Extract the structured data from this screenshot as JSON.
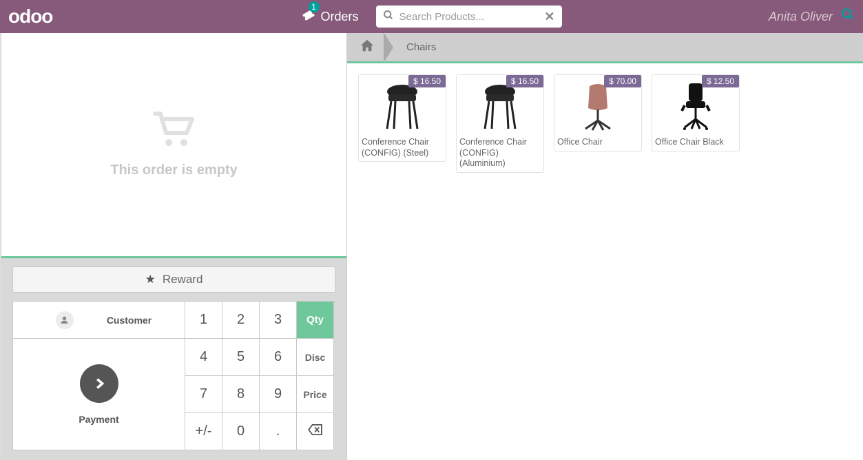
{
  "topbar": {
    "logo": "odoo",
    "orders_label": "Orders",
    "orders_badge": "1",
    "search_placeholder": "Search Products...",
    "username": "Anita Oliver"
  },
  "cart": {
    "empty_text": "This order is empty"
  },
  "controls": {
    "reward_label": "Reward",
    "customer_label": "Customer",
    "payment_label": "Payment",
    "numpad": {
      "r1c1": "1",
      "r1c2": "2",
      "r1c3": "3",
      "r2c1": "4",
      "r2c2": "5",
      "r2c3": "6",
      "r3c1": "7",
      "r3c2": "8",
      "r3c3": "9",
      "r4c1": "+/-",
      "r4c2": "0",
      "r4c3": "."
    },
    "mode": {
      "qty": "Qty",
      "disc": "Disc",
      "price": "Price"
    }
  },
  "breadcrumb": {
    "category": "Chairs"
  },
  "products": [
    {
      "name": "Conference Chair (CONFIG) (Steel)",
      "price": "$ 16.50",
      "variant": "conf-steel"
    },
    {
      "name": "Conference Chair (CONFIG) (Aluminium)",
      "price": "$ 16.50",
      "variant": "conf-alum"
    },
    {
      "name": "Office Chair",
      "price": "$ 70.00",
      "variant": "office-pink"
    },
    {
      "name": "Office Chair Black",
      "price": "$ 12.50",
      "variant": "office-black"
    }
  ]
}
